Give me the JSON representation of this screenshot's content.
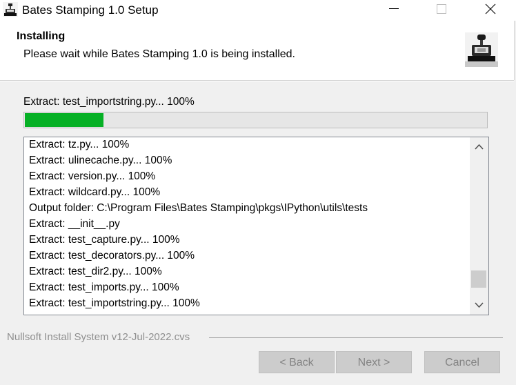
{
  "window": {
    "title": "Bates Stamping 1.0 Setup",
    "icon": "stamp-icon",
    "controls": [
      "minimize-icon",
      "maximize-icon",
      "close-icon"
    ]
  },
  "header": {
    "title": "Installing",
    "subtitle": "Please wait while Bates Stamping 1.0 is being installed.",
    "image": "stamp-image"
  },
  "status": {
    "text": "Extract: test_importstring.py... 100%",
    "progress_fraction": 0.17
  },
  "log": {
    "lines": [
      "Extract: tz.py... 100%",
      "Extract: ulinecache.py... 100%",
      "Extract: version.py... 100%",
      "Extract: wildcard.py... 100%",
      "Output folder: C:\\Program Files\\Bates Stamping\\pkgs\\IPython\\utils\\tests",
      "Extract: __init__.py",
      "Extract: test_capture.py... 100%",
      "Extract: test_decorators.py... 100%",
      "Extract: test_dir2.py... 100%",
      "Extract: test_imports.py... 100%",
      "Extract: test_importstring.py... 100%"
    ],
    "scroll_position": 0.93
  },
  "footer": {
    "brand": "Nullsoft Install System v12-Jul-2022.cvs",
    "back_label": "< Back",
    "next_label": "Next >",
    "cancel_label": "Cancel"
  },
  "colors": {
    "progress": "#06b025",
    "disabled_button": "#cccccc",
    "disabled_text": "#838383"
  }
}
